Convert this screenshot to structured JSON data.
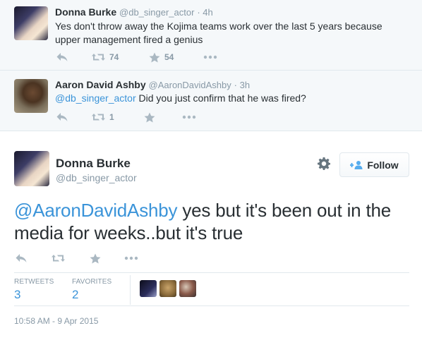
{
  "thread": [
    {
      "name": "Donna Burke",
      "handle": "@db_singer_actor",
      "time": "· 4h",
      "text": "Yes don't throw away the Kojima teams work over the last 5 years because upper management fired a genius",
      "retweets": "74",
      "favorites": "54"
    },
    {
      "name": "Aaron David Ashby",
      "handle": "@AaronDavidAshby",
      "time": "· 3h",
      "mention": "@db_singer_actor",
      "text": " Did you just confirm that he was fired?",
      "retweets": "1",
      "favorites": ""
    }
  ],
  "main_tweet": {
    "name": "Donna Burke",
    "handle": "@db_singer_actor",
    "follow_label": "Follow",
    "mention": "@AaronDavidAshby",
    "text": " yes but it's been out in the media for weeks..but it's true",
    "stats": {
      "retweets_label": "RETWEETS",
      "retweets": "3",
      "favorites_label": "FAVORITES",
      "favorites": "2"
    },
    "timestamp": "10:58 AM - 9 Apr 2015"
  },
  "colors": {
    "link": "#3b94d9",
    "muted": "#8899a6",
    "icon": "#aab8c2",
    "thread_bg": "#f5f8fa"
  },
  "icons": [
    "reply-icon",
    "retweet-icon",
    "favorite-icon",
    "more-icon",
    "gear-icon",
    "follow-person-icon"
  ]
}
